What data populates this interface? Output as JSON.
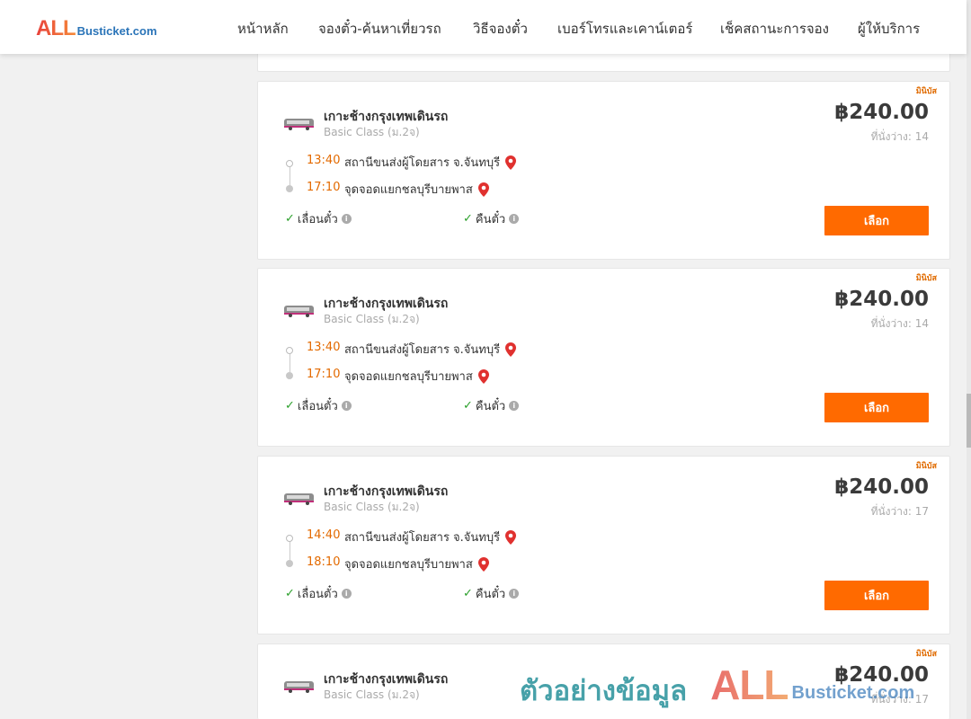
{
  "brand": {
    "logo_main": "ALL",
    "logo_rest": "Busticket.com"
  },
  "nav": [
    {
      "label": "หน้าหลัก"
    },
    {
      "label": "จองตั๋ว-ค้นหาเที่ยวรถ"
    },
    {
      "label": "วิธีจองตั๋ว"
    },
    {
      "label": "เบอร์โทรและเคาน์เตอร์"
    },
    {
      "label": "เช็คสถานะการจอง"
    },
    {
      "label": "ผู้ให้บริการ"
    }
  ],
  "trips": [
    {
      "badge": "มินิบัส",
      "operator": "เกาะช้างกรุงเทพเดินรถ",
      "class": "Basic Class (ม.2จ)",
      "price": "฿240.00",
      "seats": "ที่นั่งว่าง: 14",
      "dep_time": "13:40",
      "dep_place": "สถานีขนส่งผู้โดยสาร จ.จันทบุรี",
      "arr_time": "17:10",
      "arr_place": "จุดจอดแยกชลบุรีบายพาส",
      "feature_1": "เลื่อนตั๋ว",
      "feature_2": "คืนตั๋ว",
      "select_label": "เลือก"
    },
    {
      "badge": "มินิบัส",
      "operator": "เกาะช้างกรุงเทพเดินรถ",
      "class": "Basic Class (ม.2จ)",
      "price": "฿240.00",
      "seats": "ที่นั่งว่าง: 14",
      "dep_time": "13:40",
      "dep_place": "สถานีขนส่งผู้โดยสาร จ.จันทบุรี",
      "arr_time": "17:10",
      "arr_place": "จุดจอดแยกชลบุรีบายพาส",
      "feature_1": "เลื่อนตั๋ว",
      "feature_2": "คืนตั๋ว",
      "select_label": "เลือก"
    },
    {
      "badge": "มินิบัส",
      "operator": "เกาะช้างกรุงเทพเดินรถ",
      "class": "Basic Class (ม.2จ)",
      "price": "฿240.00",
      "seats": "ที่นั่งว่าง: 17",
      "dep_time": "14:40",
      "dep_place": "สถานีขนส่งผู้โดยสาร จ.จันทบุรี",
      "arr_time": "18:10",
      "arr_place": "จุดจอดแยกชลบุรีบายพาส",
      "feature_1": "เลื่อนตั๋ว",
      "feature_2": "คืนตั๋ว",
      "select_label": "เลือก"
    },
    {
      "badge": "มินิบัส",
      "operator": "เกาะช้างกรุงเทพเดินรถ",
      "class": "Basic Class (ม.2จ)",
      "price": "฿240.00",
      "seats": "ที่นั่งว่าง: 17"
    }
  ],
  "watermark": {
    "text": "ตัวอย่างข้อมูล",
    "logo_main": "ALL",
    "logo_rest": "Busticket.com"
  },
  "colors": {
    "accent": "#ff6a00",
    "time": "#e36a00",
    "pin": "#e0312f",
    "check": "#2ca02c"
  },
  "icons": {
    "bus": "bus-icon",
    "pin": "map-pin-icon",
    "check": "check-icon",
    "info": "info-icon"
  }
}
